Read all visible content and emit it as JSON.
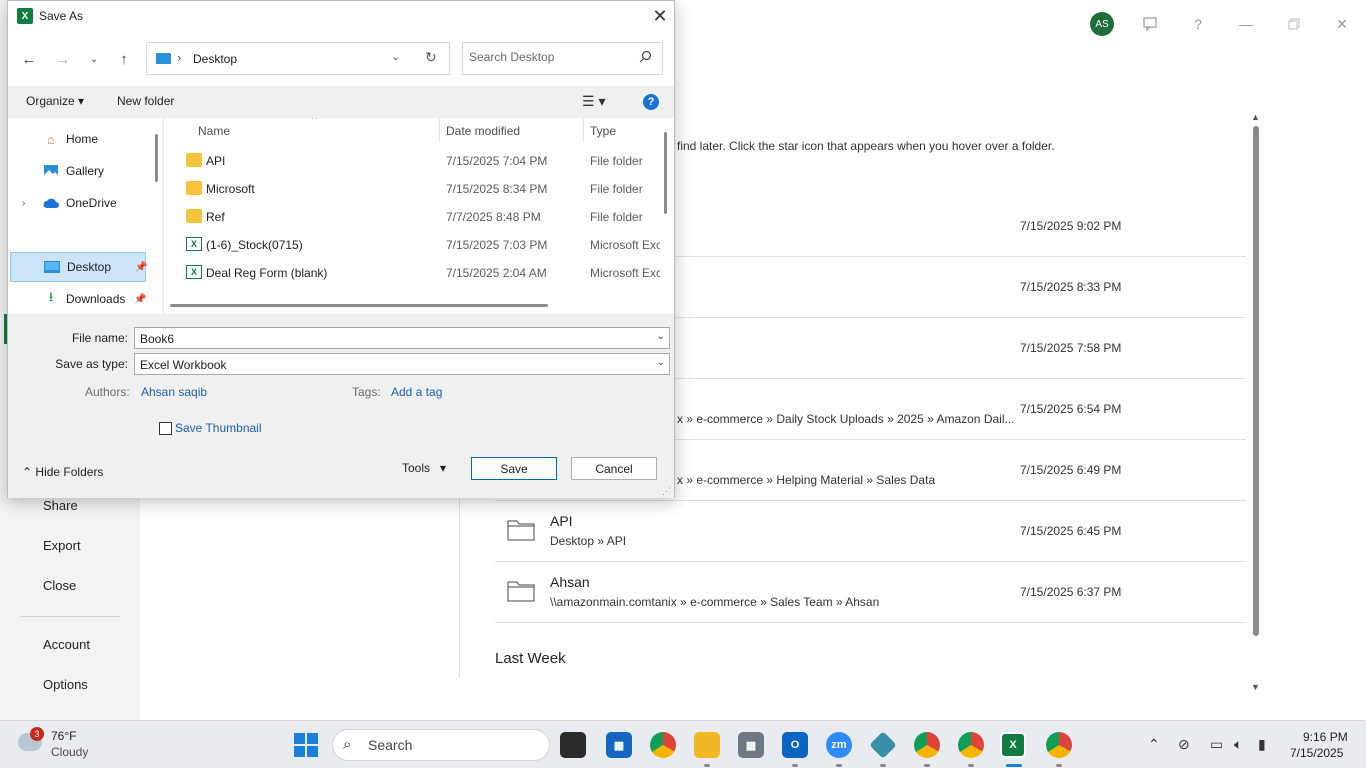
{
  "background": {
    "nav_items": [
      "Share",
      "Export",
      "Close",
      "Account",
      "Options"
    ],
    "avatar_initials": "AS",
    "hint_text": "find later. Click the star icon that appears when you hover over a folder.",
    "rows": [
      {
        "name": "",
        "path": "",
        "date": "7/15/2025 9:02 PM"
      },
      {
        "name": "",
        "path": "",
        "date": "7/15/2025 8:33 PM"
      },
      {
        "name": "",
        "path": "",
        "date": "7/15/2025 7:58 PM"
      },
      {
        "name": "",
        "path": "x » e-commerce » Daily Stock Uploads » 2025 » Amazon Dail...",
        "date": "7/15/2025 6:54 PM"
      },
      {
        "name": "",
        "path": "x » e-commerce » Helping Material » Sales Data",
        "date": "7/15/2025 6:49 PM"
      },
      {
        "name": "API",
        "path": "Desktop » API",
        "date": "7/15/2025 6:45 PM"
      },
      {
        "name": "Ahsan",
        "path": "\\\\amazonmain.comtanix » e-commerce » Sales Team » Ahsan",
        "date": "7/15/2025 6:37 PM"
      }
    ],
    "last_week_heading": "Last Week"
  },
  "dialog": {
    "title": "Save As",
    "address": {
      "location": "Desktop"
    },
    "search_placeholder": "Search Desktop",
    "organize_label": "Organize",
    "new_folder_label": "New folder",
    "nav_pane": [
      {
        "label": "Home",
        "icon": "home-icon"
      },
      {
        "label": "Gallery",
        "icon": "gallery-icon"
      },
      {
        "label": "OneDrive",
        "icon": "cloud-icon"
      },
      {
        "label": "Desktop",
        "icon": "desktop-icon",
        "selected": true
      },
      {
        "label": "Downloads",
        "icon": "download-icon"
      }
    ],
    "columns": {
      "name": "Name",
      "date": "Date modified",
      "type": "Type"
    },
    "files": [
      {
        "name": "API",
        "date": "7/15/2025 7:04 PM",
        "type": "File folder",
        "kind": "folder"
      },
      {
        "name": "Microsoft",
        "date": "7/15/2025 8:34 PM",
        "type": "File folder",
        "kind": "folder"
      },
      {
        "name": "Ref",
        "date": "7/7/2025 8:48 PM",
        "type": "File folder",
        "kind": "folder"
      },
      {
        "name": "(1-6)_Stock(0715)",
        "date": "7/15/2025 7:03 PM",
        "type": "Microsoft Exc",
        "kind": "excel"
      },
      {
        "name": "Deal Reg Form (blank)",
        "date": "7/15/2025 2:04 AM",
        "type": "Microsoft Exc",
        "kind": "excel"
      }
    ],
    "file_name_label": "File name:",
    "file_name_value": "Book6",
    "save_type_label": "Save as type:",
    "save_type_value": "Excel Workbook",
    "authors_label": "Authors:",
    "authors_value": "Ahsan saqib",
    "tags_label": "Tags:",
    "tags_value": "Add a tag",
    "thumbnail_label": "Save Thumbnail",
    "hide_folders_label": "Hide Folders",
    "tools_label": "Tools",
    "save_label": "Save",
    "cancel_label": "Cancel"
  },
  "taskbar": {
    "weather_badge": "3",
    "weather_temp": "76°F",
    "weather_desc": "Cloudy",
    "search_placeholder": "Search",
    "time": "9:16 PM",
    "date": "7/15/2025"
  }
}
